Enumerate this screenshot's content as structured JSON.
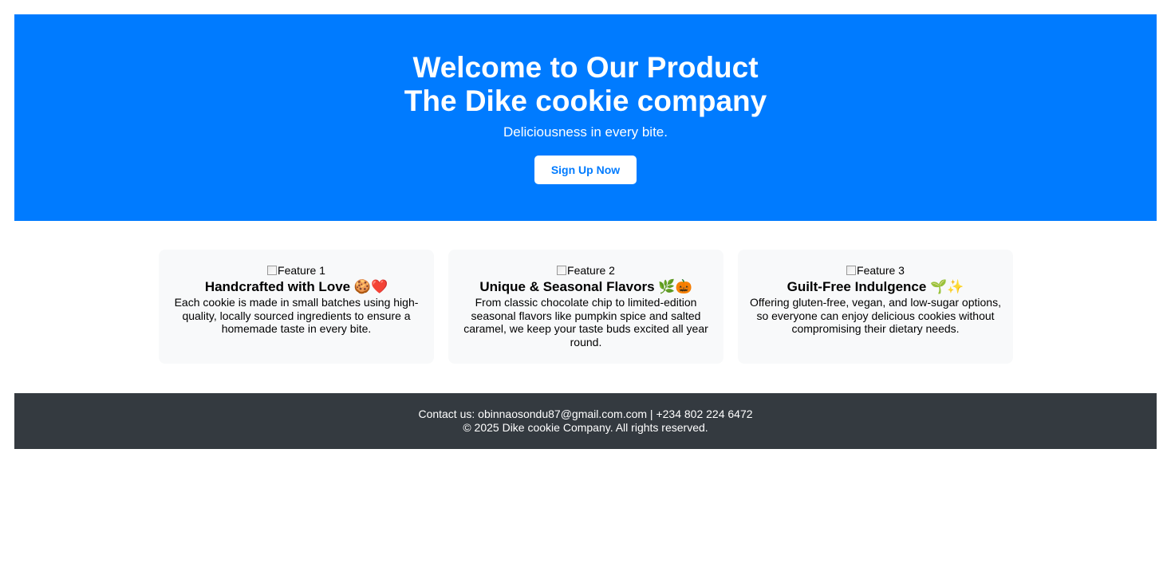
{
  "hero": {
    "title_line1": "Welcome to Our Product",
    "title_line2": "The Dike cookie company",
    "tagline": "Deliciousness in every bite.",
    "cta_label": "Sign Up Now"
  },
  "features": [
    {
      "image_alt": "Feature 1",
      "title": "Handcrafted with Love 🍪❤️",
      "description": "Each cookie is made in small batches using high-quality, locally sourced ingredients to ensure a homemade taste in every bite."
    },
    {
      "image_alt": "Feature 2",
      "title": "Unique & Seasonal Flavors 🌿🎃",
      "description": "From classic chocolate chip to limited-edition seasonal flavors like pumpkin spice and salted caramel, we keep your taste buds excited all year round."
    },
    {
      "image_alt": "Feature 3",
      "title": "Guilt-Free Indulgence 🌱✨",
      "description": "Offering gluten-free, vegan, and low-sugar options, so everyone can enjoy delicious cookies without compromising their dietary needs."
    }
  ],
  "footer": {
    "contact": "Contact us: obinnaosondu87@gmail.com.com | +234 802 224 6472",
    "copyright": "© 2025 Dike cookie Company. All rights reserved."
  },
  "colors": {
    "hero_background": "#007bff",
    "card_background": "#f8f9fa",
    "footer_background": "#343a40"
  }
}
